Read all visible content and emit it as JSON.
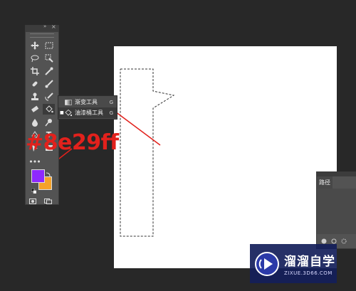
{
  "toolbox": {
    "collapse_icon": "»",
    "close_icon": "×",
    "type_tool_label": "T",
    "more_tools_label": "•••"
  },
  "colors": {
    "foreground": "#8e29ff",
    "background": "#f5a22a",
    "annotation_red": "#e2211c",
    "marching_ants": "#333333"
  },
  "flyout": {
    "items": [
      {
        "label": "渐变工具",
        "shortcut": "G",
        "icon": "gradient-icon"
      },
      {
        "label": "油漆桶工具",
        "shortcut": "G",
        "icon": "paint-bucket-icon"
      }
    ]
  },
  "annotation": {
    "hex_text": "#8e29ff"
  },
  "paths_panel": {
    "tab_label": "路径"
  },
  "watermark": {
    "name": "溜溜自学",
    "url": "ZIXUE.3D66.COM"
  }
}
